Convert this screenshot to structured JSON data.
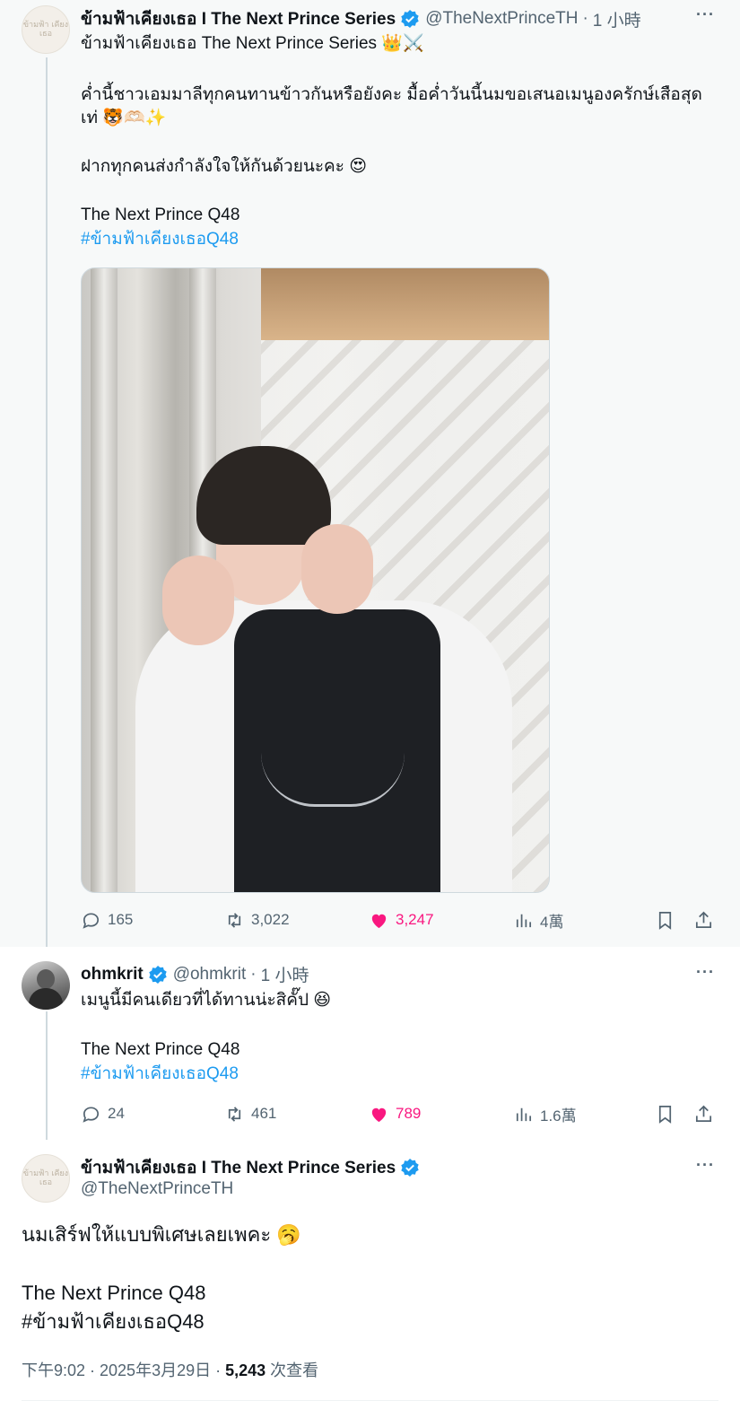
{
  "tweet1": {
    "avatar_text": "ข้ามฟ้า เคียงเธอ",
    "name": "ข้ามฟ้าเคียงเธอ I The Next Prince Series",
    "handle": "@TheNextPrinceTH",
    "separator": "·",
    "time": "1 小時",
    "more": "···",
    "lines": [
      "ข้ามฟ้าเคียงเธอ The Next Prince Series 👑⚔️",
      "ค่ำนี้ชาวเอมมาลีทุกคนทานข้าวกันหรือยังคะ มื้อค่ำวันนี้นมขอเสนอเมนูองครักษ์เสือสุด",
      "เท่ 🐯🫶🏻✨",
      "ฝากทุกคนส่งกำลังใจให้กันด้วยนะคะ 😍",
      "The Next Prince Q48"
    ],
    "hashtag": "#ข้ามฟ้าเคียงเธอQ48",
    "stats": {
      "replies": "165",
      "retweets": "3,022",
      "likes": "3,247",
      "views": "4萬"
    }
  },
  "tweet2": {
    "name": "ohmkrit",
    "handle": "@ohmkrit",
    "separator": "·",
    "time": "1 小時",
    "more": "···",
    "lines": [
      "เมนูนี้มีคนเดียวที่ได้ทานน่ะสิคั๊ป 😆",
      "The Next Prince Q48"
    ],
    "hashtag": "#ข้ามฟ้าเคียงเธอQ48",
    "stats": {
      "replies": "24",
      "retweets": "461",
      "likes": "789",
      "views": "1.6萬"
    }
  },
  "tweet3": {
    "avatar_text": "ข้ามฟ้า เคียงเธอ",
    "name": "ข้ามฟ้าเคียงเธอ I The Next Prince Series",
    "handle": "@TheNextPrinceTH",
    "more": "···",
    "lines": [
      "นมเสิร์ฟให้แบบพิเศษเลยเพคะ 🥱",
      "The Next Prince Q48"
    ],
    "hashtag": "#ข้ามฟ้าเคียงเธอQ48",
    "timestamp": "下午9:02 · 2025年3月29日 · ",
    "views_count": "5,243",
    "views_label": " 次查看"
  },
  "colors": {
    "accent": "#1d9bf0",
    "like": "#f91880",
    "muted": "#536471",
    "text": "#0f1419",
    "highlight_bg": "#f7f9f9"
  }
}
